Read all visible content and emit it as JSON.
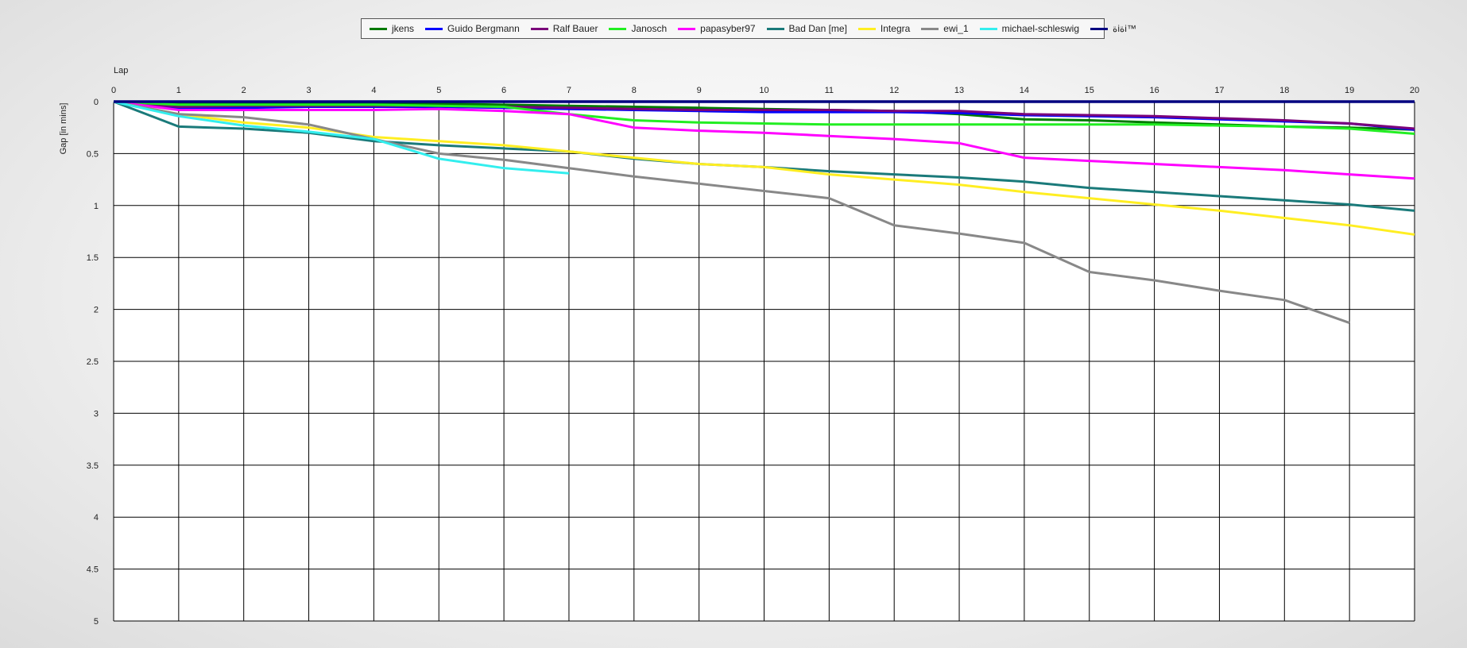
{
  "chart_data": {
    "type": "line",
    "xlabel": "Lap",
    "ylabel": "Gap [in mins]",
    "xlim": [
      0,
      20
    ],
    "ylim": [
      0,
      5
    ],
    "x_ticks": [
      0,
      1,
      2,
      3,
      4,
      5,
      6,
      7,
      8,
      9,
      10,
      11,
      12,
      13,
      14,
      15,
      16,
      17,
      18,
      19,
      20
    ],
    "y_ticks": [
      0,
      0.5,
      1,
      1.5,
      2,
      2.5,
      3,
      3.5,
      4,
      4.5,
      5
    ],
    "y_inverted": true,
    "grid": true,
    "legend_position": "top-center",
    "series": [
      {
        "name": "jkens",
        "color": "#007a00",
        "x": [
          0,
          1,
          2,
          3,
          4,
          5,
          6,
          7,
          8,
          9,
          10,
          11,
          12,
          13,
          14,
          15,
          16,
          17,
          18,
          19,
          20
        ],
        "y": [
          0,
          0.02,
          0.02,
          0.02,
          0.02,
          0.02,
          0.03,
          0.04,
          0.05,
          0.06,
          0.07,
          0.08,
          0.09,
          0.12,
          0.17,
          0.18,
          0.2,
          0.22,
          0.24,
          0.25,
          0.27
        ]
      },
      {
        "name": "Guido Bergmann",
        "color": "#0000ff",
        "x": [
          0,
          1,
          2,
          3,
          4,
          5,
          6,
          7,
          8,
          9,
          10,
          11,
          12,
          13,
          14,
          15,
          16,
          17,
          18,
          19,
          20
        ],
        "y": [
          0,
          0.06,
          0.06,
          0.05,
          0.05,
          0.05,
          0.06,
          0.07,
          0.08,
          0.09,
          0.1,
          0.1,
          0.1,
          0.11,
          0.13,
          0.14,
          0.15,
          0.17,
          0.19,
          0.21,
          0.27
        ]
      },
      {
        "name": "Ralf Bauer",
        "color": "#7a007a",
        "x": [
          0,
          1,
          2,
          3,
          4,
          5,
          6,
          7,
          8,
          9,
          10,
          11,
          12,
          13,
          14,
          15,
          16,
          17,
          18,
          19,
          20
        ],
        "y": [
          0,
          0.05,
          0.04,
          0.04,
          0.04,
          0.04,
          0.05,
          0.06,
          0.07,
          0.08,
          0.08,
          0.08,
          0.09,
          0.09,
          0.12,
          0.13,
          0.14,
          0.16,
          0.18,
          0.21,
          0.26
        ]
      },
      {
        "name": "Janosch",
        "color": "#22ee22",
        "x": [
          0,
          1,
          2,
          3,
          4,
          5,
          6,
          7,
          8,
          9,
          10,
          11,
          12,
          13,
          14,
          15,
          16,
          17,
          18,
          19,
          20
        ],
        "y": [
          0,
          0.03,
          0.03,
          0.03,
          0.03,
          0.04,
          0.05,
          0.12,
          0.18,
          0.2,
          0.21,
          0.22,
          0.22,
          0.22,
          0.22,
          0.22,
          0.22,
          0.23,
          0.24,
          0.26,
          0.31
        ]
      },
      {
        "name": "papasyber97",
        "color": "#ff00ff",
        "x": [
          0,
          1,
          2,
          3,
          4,
          5,
          6,
          7,
          8,
          9,
          10,
          11,
          12,
          13,
          14,
          15,
          16,
          17,
          18,
          19,
          20
        ],
        "y": [
          0,
          0.08,
          0.08,
          0.08,
          0.08,
          0.07,
          0.09,
          0.12,
          0.25,
          0.28,
          0.3,
          0.33,
          0.36,
          0.4,
          0.54,
          0.57,
          0.6,
          0.63,
          0.66,
          0.7,
          0.74
        ]
      },
      {
        "name": "Bad Dan [me]",
        "color": "#1a7a7a",
        "x": [
          0,
          1,
          2,
          3,
          4,
          5,
          6,
          7,
          8,
          9,
          10,
          11,
          12,
          13,
          14,
          15,
          16,
          17,
          18,
          19,
          20
        ],
        "y": [
          0,
          0.24,
          0.26,
          0.3,
          0.38,
          0.42,
          0.45,
          0.48,
          0.55,
          0.6,
          0.63,
          0.67,
          0.7,
          0.73,
          0.77,
          0.83,
          0.87,
          0.91,
          0.95,
          0.99,
          1.05
        ]
      },
      {
        "name": "Integra",
        "color": "#ffee22",
        "x": [
          0,
          1,
          2,
          3,
          4,
          5,
          6,
          7,
          8,
          9,
          10,
          11,
          12,
          13,
          14,
          15,
          16,
          17,
          18,
          19,
          20
        ],
        "y": [
          0,
          0.12,
          0.2,
          0.25,
          0.34,
          0.38,
          0.42,
          0.48,
          0.54,
          0.6,
          0.63,
          0.7,
          0.75,
          0.8,
          0.87,
          0.93,
          0.99,
          1.05,
          1.12,
          1.19,
          1.28
        ]
      },
      {
        "name": "ewi_1",
        "color": "#888888",
        "x": [
          0,
          1,
          2,
          3,
          4,
          5,
          6,
          7,
          8,
          9,
          10,
          11,
          12,
          13,
          14,
          15,
          16,
          17,
          18,
          19
        ],
        "y": [
          0,
          0.12,
          0.15,
          0.22,
          0.36,
          0.5,
          0.56,
          0.64,
          0.72,
          0.79,
          0.86,
          0.93,
          1.19,
          1.27,
          1.36,
          1.64,
          1.72,
          1.82,
          1.91,
          2.13
        ]
      },
      {
        "name": "michael-schleswig",
        "color": "#33eeee",
        "x": [
          0,
          1,
          2,
          3,
          4,
          5,
          6,
          7
        ],
        "y": [
          0,
          0.14,
          0.23,
          0.29,
          0.36,
          0.55,
          0.64,
          0.69
        ]
      },
      {
        "name": "ةiةi™",
        "color": "#000080",
        "x": [
          0,
          1,
          2,
          3,
          4,
          5,
          6,
          7,
          8,
          9,
          10,
          11,
          12,
          13,
          14,
          15,
          16,
          17,
          18,
          19,
          20
        ],
        "y": [
          0,
          0,
          0,
          0,
          0,
          0,
          0,
          0,
          0,
          0,
          0,
          0,
          0,
          0,
          0,
          0,
          0,
          0,
          0,
          0,
          0
        ]
      }
    ]
  }
}
